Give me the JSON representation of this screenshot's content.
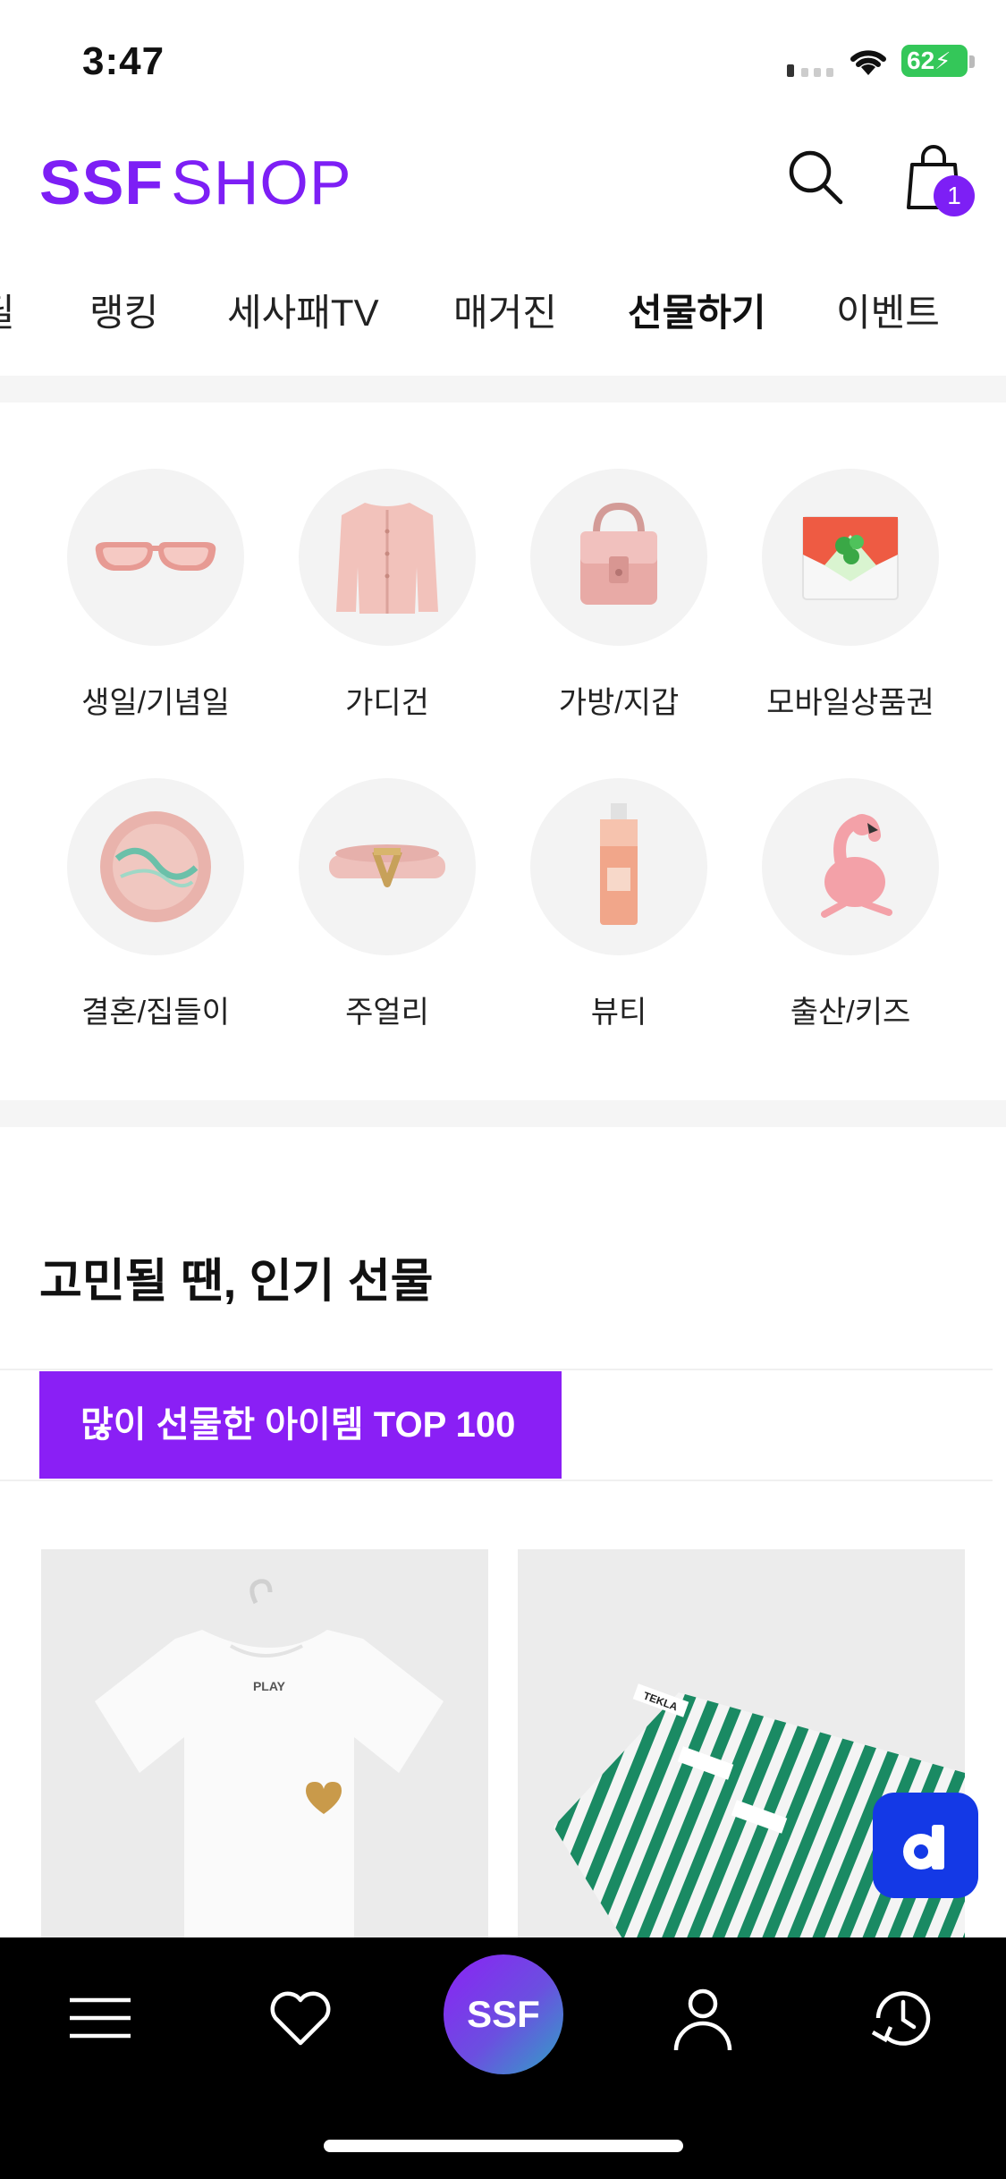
{
  "status_bar": {
    "time": "3:47",
    "battery": "62"
  },
  "header": {
    "logo_bold": "SSF",
    "logo_light": "SHOP",
    "cart_count": "1"
  },
  "tabs": [
    "딜",
    "랭킹",
    "세사패TV",
    "매거진",
    "선물하기",
    "이벤트"
  ],
  "active_tab": "선물하기",
  "categories": [
    {
      "label": "생일/기념일",
      "icon": "sunglasses-icon"
    },
    {
      "label": "가디건",
      "icon": "cardigan-icon"
    },
    {
      "label": "가방/지갑",
      "icon": "handbag-icon"
    },
    {
      "label": "모바일상품권",
      "icon": "gift-card-icon"
    },
    {
      "label": "결혼/집들이",
      "icon": "plate-icon"
    },
    {
      "label": "주얼리",
      "icon": "bracelet-icon"
    },
    {
      "label": "뷰티",
      "icon": "perfume-bottle-icon"
    },
    {
      "label": "출산/키즈",
      "icon": "flamingo-toy-icon"
    }
  ],
  "section": {
    "title": "고민될 땐, 인기 선물",
    "top_button": "많이 선물한 아이템 TOP 100"
  },
  "products": [
    {
      "name": "t-shirt-product",
      "tag": "PLAY"
    },
    {
      "name": "towel-product",
      "tag": "TEKLA"
    }
  ],
  "bottom_nav": {
    "center_label": "SSF"
  },
  "colors": {
    "brand": "#7d1ff5",
    "fab": "#1439e6",
    "tab_bar": "#000000"
  }
}
